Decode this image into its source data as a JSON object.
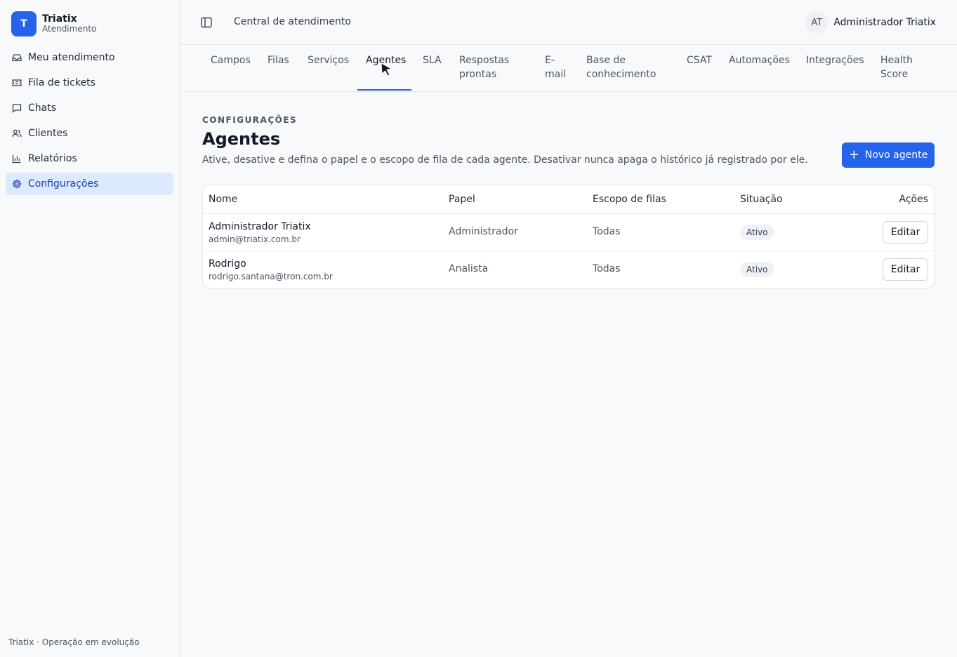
{
  "brand": {
    "initial": "T",
    "name": "Triatix",
    "subtitle": "Atendimento"
  },
  "sidebar": {
    "items": [
      {
        "label": "Meu atendimento",
        "icon": "inbox-icon",
        "active": false
      },
      {
        "label": "Fila de tickets",
        "icon": "ticket-icon",
        "active": false
      },
      {
        "label": "Chats",
        "icon": "chat-icon",
        "active": false
      },
      {
        "label": "Clientes",
        "icon": "users-icon",
        "active": false
      },
      {
        "label": "Relatórios",
        "icon": "bar-chart-icon",
        "active": false
      },
      {
        "label": "Configurações",
        "icon": "gear-icon",
        "active": true
      }
    ],
    "footer": "Triatix · Operação em evolução"
  },
  "topbar": {
    "breadcrumb": "Central de atendimento",
    "user": {
      "initials": "AT",
      "name": "Administrador Triatix"
    }
  },
  "tabs": [
    {
      "label": "Campos"
    },
    {
      "label": "Filas"
    },
    {
      "label": "Serviços"
    },
    {
      "label": "Agentes",
      "active": true
    },
    {
      "label": "SLA"
    },
    {
      "label": "Respostas prontas"
    },
    {
      "label": "E-mail"
    },
    {
      "label": "Base de conhecimento"
    },
    {
      "label": "CSAT"
    },
    {
      "label": "Automações"
    },
    {
      "label": "Integrações"
    },
    {
      "label": "Health Score"
    }
  ],
  "page": {
    "eyebrow": "CONFIGURAÇÕES",
    "title": "Agentes",
    "description": "Ative, desative e defina o papel e o escopo de fila de cada agente. Desativar nunca apaga o histórico já registrado por ele.",
    "new_button": "Novo agente"
  },
  "table": {
    "columns": [
      "Nome",
      "Papel",
      "Escopo de filas",
      "Situação",
      "Ações"
    ],
    "rows": [
      {
        "name": "Administrador Triatix",
        "email": "admin@triatix.com.br",
        "role": "Administrador",
        "scope": "Todas",
        "status": "Ativo",
        "action": "Editar"
      },
      {
        "name": "Rodrigo",
        "email": "rodrigo.santana@tron.com.br",
        "role": "Analista",
        "scope": "Todas",
        "status": "Ativo",
        "action": "Editar"
      }
    ]
  },
  "colors": {
    "accent": "#2563eb",
    "active_nav_bg": "#dbeafe"
  }
}
